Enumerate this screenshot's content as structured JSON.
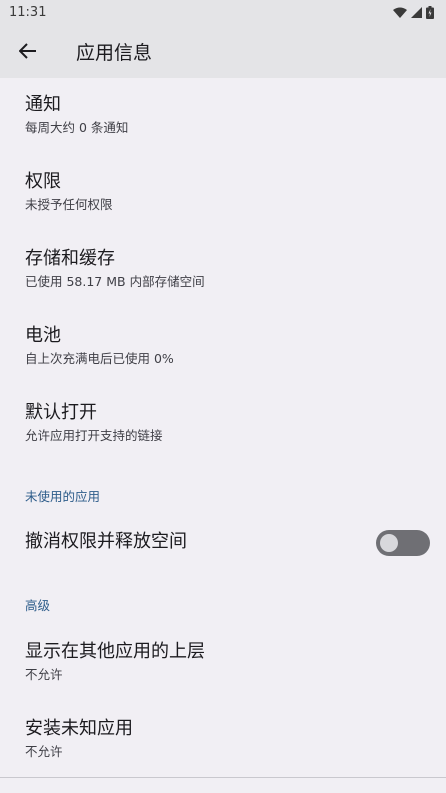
{
  "status": {
    "time": "11:31"
  },
  "header": {
    "title": "应用信息"
  },
  "items": [
    {
      "title": "通知",
      "subtitle": "每周大约 0 条通知"
    },
    {
      "title": "权限",
      "subtitle": "未授予任何权限"
    },
    {
      "title": "存储和缓存",
      "subtitle": "已使用 58.17 MB 内部存储空间"
    },
    {
      "title": "电池",
      "subtitle": "自上次充满电后已使用 0%"
    },
    {
      "title": "默认打开",
      "subtitle": "允许应用打开支持的链接"
    }
  ],
  "section_unused": "未使用的应用",
  "unused_toggle": {
    "title": "撤消权限并释放空间",
    "on": false
  },
  "section_advanced": "高级",
  "advanced_items": [
    {
      "title": "显示在其他应用的上层",
      "subtitle": "不允许"
    },
    {
      "title": "安装未知应用",
      "subtitle": "不允许"
    }
  ]
}
